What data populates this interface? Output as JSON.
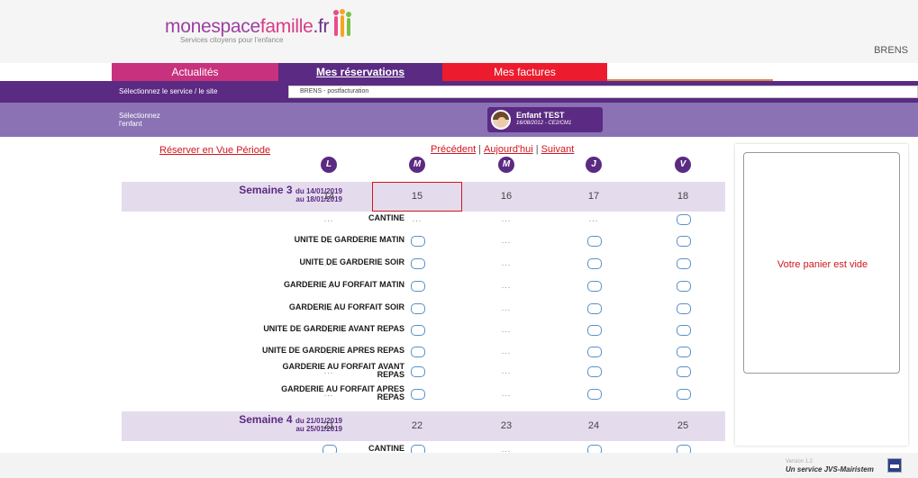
{
  "header": {
    "logo": {
      "part1": "monespace",
      "part2": "famille",
      "part3": ".fr"
    },
    "logo_subtitle": "Services citoyens pour l'enfance",
    "city": "BRENS"
  },
  "tabs": [
    {
      "label": "Actualités"
    },
    {
      "label": "Mes réservations"
    },
    {
      "label": "Mes factures"
    }
  ],
  "service": {
    "label": "Sélectionnez le service / le site",
    "selected": "BRENS - postfacturation"
  },
  "child": {
    "label_line1": "Sélectionnez",
    "label_line2": "l'enfant",
    "name": "Enfant TEST",
    "info": "16/08/2012 - CE2/CM1"
  },
  "nav": {
    "reserve_period": "Réserver en Vue Période",
    "prev": "Précédent",
    "today": "Aujourd'hui",
    "next": "Suivant",
    "sep1": "|",
    "sep2": "|"
  },
  "days": [
    "L",
    "M",
    "M",
    "J",
    "V"
  ],
  "weeks": [
    {
      "title": "Semaine 3",
      "from": "du 14/01/2019",
      "to": "au 18/01/2019",
      "days": [
        "14",
        "15",
        "16",
        "17",
        "18"
      ]
    },
    {
      "title": "Semaine 4",
      "from": "du 21/01/2019",
      "to": "au 25/01/2019",
      "days": [
        "21",
        "22",
        "23",
        "24",
        "25"
      ]
    }
  ],
  "services": [
    {
      "label": "CANTINE",
      "cells": [
        "dots",
        "dots",
        "dots",
        "dots",
        "check"
      ]
    },
    {
      "label": "UNITE DE GARDERIE MATIN",
      "cells": [
        "dots",
        "check",
        "dots",
        "check",
        "check"
      ]
    },
    {
      "label": "UNITE DE GARDERIE SOIR",
      "cells": [
        "dots",
        "check",
        "dots",
        "check",
        "check"
      ]
    },
    {
      "label": "GARDERIE AU FORFAIT MATIN",
      "cells": [
        "dots",
        "check",
        "dots",
        "check",
        "check"
      ]
    },
    {
      "label": "GARDERIE AU FORFAIT SOIR",
      "cells": [
        "dots",
        "check",
        "dots",
        "check",
        "check"
      ]
    },
    {
      "label": "UNITE DE GARDERIE AVANT REPAS",
      "cells": [
        "dots",
        "check",
        "dots",
        "check",
        "check"
      ]
    },
    {
      "label": "UNITE DE GARDERIE APRES REPAS",
      "cells": [
        "dots",
        "check",
        "dots",
        "check",
        "check"
      ]
    },
    {
      "label_line1": "GARDERIE AU FORFAIT AVANT",
      "label_line2": "REPAS",
      "cells": [
        "dots",
        "check",
        "dots",
        "check",
        "check"
      ]
    },
    {
      "label_line1": "GARDERIE AU FORFAIT APRES",
      "label_line2": "REPAS",
      "cells": [
        "dots",
        "check",
        "dots",
        "check",
        "check"
      ]
    }
  ],
  "week4_first_row": {
    "label": "CANTINE"
  },
  "dots_text": "...",
  "basket": {
    "empty_text": "Votre panier est vide"
  },
  "footer": {
    "version": "Version 1.2",
    "service": "Un service JVS-Mairistem"
  },
  "colors": {
    "purple_dark": "#5b2a82",
    "purple_light": "#8a72b5",
    "pink": "#c7317d",
    "red": "#ec1c2e",
    "link_red": "#d0161e"
  }
}
